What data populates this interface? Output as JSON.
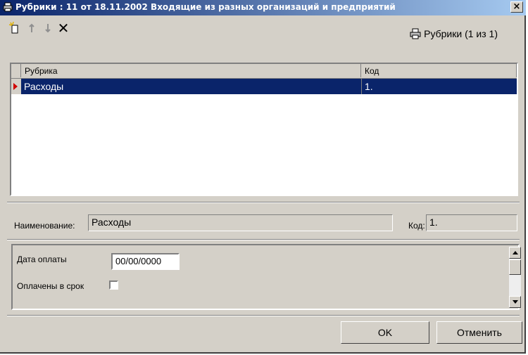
{
  "window": {
    "title": "Рубрики : 11 от 18.11.2002 Входящие из разных организаций и предприятий",
    "close_label": "×"
  },
  "toolbar": {
    "add_icon": "new-record-icon",
    "up_icon": "arrow-up-icon",
    "down_icon": "arrow-down-icon",
    "delete_label": "✕",
    "rubric_counter": "Рубрики (1 из 1)"
  },
  "grid": {
    "columns": [
      "Рубрика",
      "Код"
    ],
    "rows": [
      {
        "rubric": "Расходы",
        "code": "1."
      }
    ]
  },
  "details": {
    "name_label": "Наименование:",
    "name_value": "Расходы",
    "code_label": "Код:",
    "code_value": "1."
  },
  "fields": {
    "pay_date_label": "Дата оплаты",
    "pay_date_value": "00/00/0000",
    "paid_on_time_label": "Оплачены в срок",
    "paid_on_time_checked": false
  },
  "buttons": {
    "ok": "OK",
    "cancel": "Отменить"
  },
  "colors": {
    "title_start": "#0a246a",
    "title_end": "#a6caf0",
    "selection": "#0a246a",
    "face": "#d4d0c8",
    "indicator": "#d00000"
  }
}
